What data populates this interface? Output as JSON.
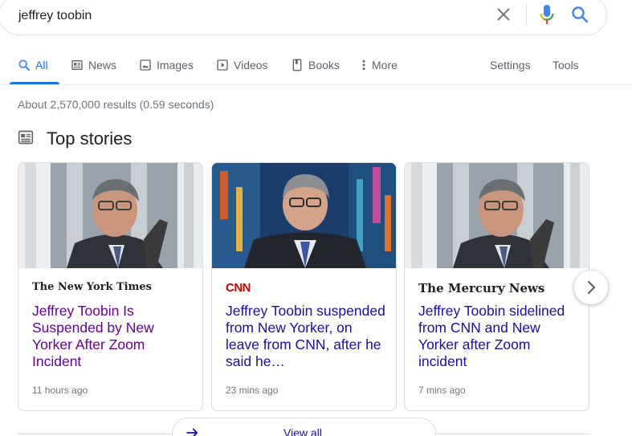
{
  "search": {
    "query": "jeffrey toobin"
  },
  "tabs": [
    {
      "label": "All",
      "icon": "search-icon"
    },
    {
      "label": "News",
      "icon": "news-icon"
    },
    {
      "label": "Images",
      "icon": "image-icon"
    },
    {
      "label": "Videos",
      "icon": "video-icon"
    },
    {
      "label": "Books",
      "icon": "book-icon"
    },
    {
      "label": "More",
      "icon": "more-vert-icon"
    }
  ],
  "tools": {
    "settings": "Settings",
    "tools": "Tools"
  },
  "stats": "About 2,570,000 results (0.59 seconds)",
  "top_stories": {
    "title": "Top stories"
  },
  "cards": [
    {
      "source": "The New York Times",
      "headline": "Jeffrey Toobin Is Suspended by New Yorker After Zoom Incident",
      "time": "11 hours ago"
    },
    {
      "source": "CNN",
      "headline": "Jeffrey Toobin suspended from New Yorker, on leave from CNN, after he said he…",
      "time": "23 mins ago"
    },
    {
      "source": "The Mercury News",
      "headline": "Jeffrey Toobin sidelined from CNN and New Yorker after Zoom incident",
      "time": "7 mins ago"
    }
  ],
  "view_all": "View all",
  "colors": {
    "accent": "#1a73e8",
    "link": "#1a0dab",
    "visited": "#660099",
    "cnn_red": "#cc0000"
  }
}
